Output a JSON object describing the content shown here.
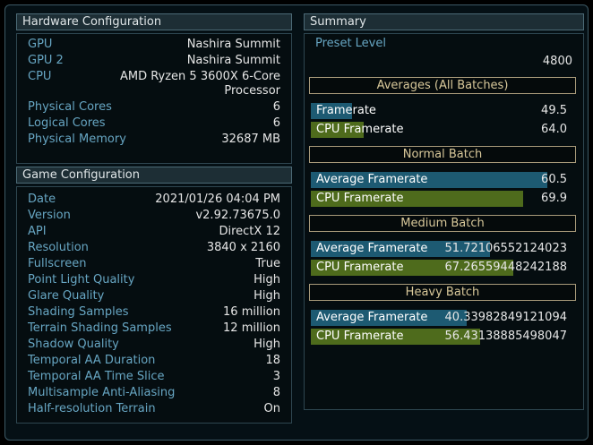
{
  "hardware": {
    "title": "Hardware Configuration",
    "rows": [
      {
        "key": "GPU",
        "value": "Nashira Summit"
      },
      {
        "key": "GPU 2",
        "value": "Nashira Summit"
      },
      {
        "key": "CPU",
        "value_line1": "AMD Ryzen 5 3600X 6-Core",
        "value_line2": "Processor"
      },
      {
        "key": "Physical Cores",
        "value": "6"
      },
      {
        "key": "Logical Cores",
        "value": "6"
      },
      {
        "key": "Physical Memory",
        "value": "32687 MB"
      }
    ]
  },
  "game": {
    "title": "Game Configuration",
    "rows": [
      {
        "key": "Date",
        "value": "2021/01/26 04:04 PM"
      },
      {
        "key": "Version",
        "value": "v2.92.73675.0"
      },
      {
        "key": "API",
        "value": "DirectX 12"
      },
      {
        "key": "Resolution",
        "value": "3840 x 2160"
      },
      {
        "key": "Fullscreen",
        "value": "True"
      },
      {
        "key": "Point Light Quality",
        "value": "High"
      },
      {
        "key": "Glare Quality",
        "value": "High"
      },
      {
        "key": "Shading Samples",
        "value": "16 million"
      },
      {
        "key": "Terrain Shading Samples",
        "value": "12 million"
      },
      {
        "key": "Shadow Quality",
        "value": "High"
      },
      {
        "key": "Temporal AA Duration",
        "value": "18"
      },
      {
        "key": "Temporal AA Time Slice",
        "value": "3"
      },
      {
        "key": "Multisample Anti-Aliasing",
        "value": "8"
      },
      {
        "key": "Half-resolution Terrain",
        "value": "On"
      }
    ]
  },
  "summary": {
    "title": "Summary",
    "preset_label": "Preset Level",
    "preset_value": "4800",
    "batches": [
      {
        "title": "Averages (All Batches)",
        "rows": [
          {
            "label": "Framerate",
            "value": "49.5",
            "fill": 0.156
          },
          {
            "label": "CPU Framerate",
            "value": "64.0",
            "fill": 0.202
          }
        ]
      },
      {
        "title": "Normal Batch",
        "rows": [
          {
            "label": "Average Framerate",
            "value": "60.5",
            "fill": 0.898
          },
          {
            "label": "CPU Framerate",
            "value": "69.9",
            "fill": 0.807
          }
        ]
      },
      {
        "title": "Medium Batch",
        "rows": [
          {
            "label": "Average Framerate",
            "value": "51.72106552124023",
            "fill": 0.681
          },
          {
            "label": "CPU Framerate",
            "value": "67.26559448242188",
            "fill": 0.768
          }
        ]
      },
      {
        "title": "Heavy Batch",
        "rows": [
          {
            "label": "Average Framerate",
            "value": "40.33982849121094",
            "fill": 0.593
          },
          {
            "label": "CPU Framerate",
            "value": "56.43138885498047",
            "fill": 0.644
          }
        ]
      }
    ],
    "colors": {
      "fps_bar": "#1d5a72",
      "cpu_bar": "#4e6b1c",
      "batch_border": "#a89a7a"
    }
  }
}
